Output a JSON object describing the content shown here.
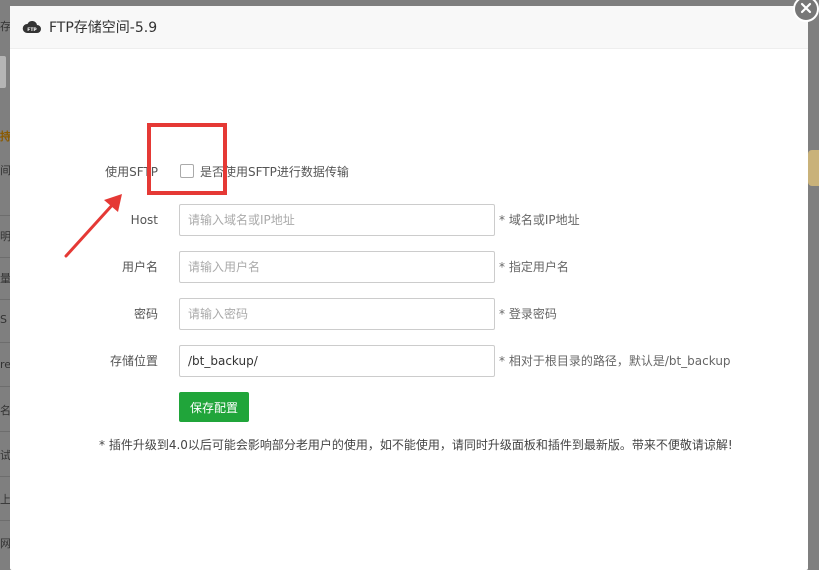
{
  "dialog": {
    "title": "FTP存储空间-5.9",
    "icon": "cloud-ftp-icon",
    "close_icon": "close-icon"
  },
  "form": {
    "sftp": {
      "label": "使用SFTP",
      "checkbox_text": "是否使用SFTP进行数据传输",
      "checked": false
    },
    "host": {
      "label": "Host",
      "value": "",
      "placeholder": "请输入域名或IP地址",
      "hint": "* 域名或IP地址"
    },
    "username": {
      "label": "用户名",
      "value": "",
      "placeholder": "请输入用户名",
      "hint": "* 指定用户名"
    },
    "password": {
      "label": "密码",
      "value": "",
      "placeholder": "请输入密码",
      "hint": "* 登录密码"
    },
    "storage_path": {
      "label": "存储位置",
      "value": "/bt_backup/",
      "placeholder": "",
      "hint": "* 相对于根目录的路径，默认是/bt_backup"
    },
    "save_label": "保存配置"
  },
  "notice": "* 插件升级到4.0以后可能会影响部分老用户的使用，如不能使用，请同时升级面板和插件到最新版。带来不便敬请谅解!",
  "background_fragments": [
    "存",
    "持",
    "间",
    "明",
    "量",
    "S",
    "re",
    "名",
    "试",
    "上",
    "网"
  ],
  "colors": {
    "primary_button": "#20a53a",
    "annotation": "#e53935",
    "overlay": "#7f7f7f"
  }
}
